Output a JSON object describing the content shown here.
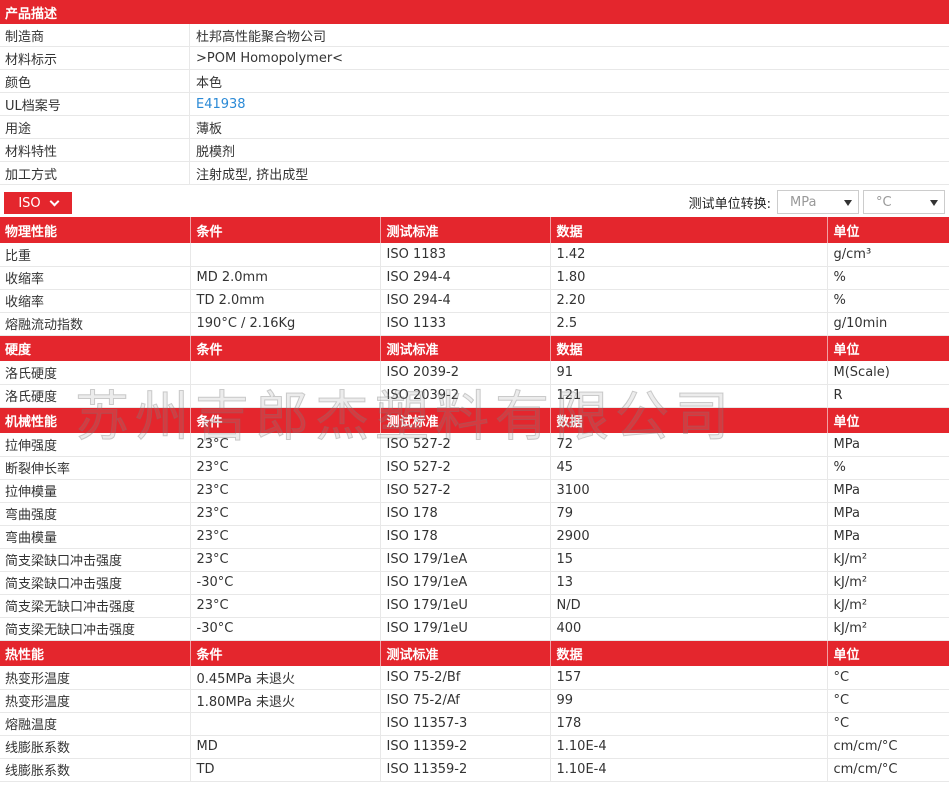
{
  "description": {
    "title": "产品描述",
    "rows": [
      {
        "key": "制造商",
        "value": "杜邦高性能聚合物公司"
      },
      {
        "key": "材料标示",
        "value": ">POM Homopolymer<"
      },
      {
        "key": "颜色",
        "value": "本色"
      },
      {
        "key": "UL档案号",
        "value": "E41938"
      },
      {
        "key": "用途",
        "value": "薄板"
      },
      {
        "key": "材料特性",
        "value": "脱模剂"
      },
      {
        "key": "加工方式",
        "value": "注射成型, 挤出成型"
      }
    ]
  },
  "toolbar": {
    "standard": "ISO",
    "unit_label": "测试单位转换:",
    "pressure_unit": "MPa",
    "temp_unit": "°C"
  },
  "columns": {
    "condition": "条件",
    "standard": "测试标准",
    "data": "数据",
    "unit": "单位"
  },
  "sections": [
    {
      "title": "物理性能",
      "rows": [
        [
          "比重",
          "",
          "ISO 1183",
          "1.42",
          "g/cm³"
        ],
        [
          "收缩率",
          "MD 2.0mm",
          "ISO 294-4",
          "1.80",
          "%"
        ],
        [
          "收缩率",
          "TD 2.0mm",
          "ISO 294-4",
          "2.20",
          "%"
        ],
        [
          "熔融流动指数",
          "190°C / 2.16Kg",
          "ISO 1133",
          "2.5",
          "g/10min"
        ]
      ]
    },
    {
      "title": "硬度",
      "rows": [
        [
          "洛氏硬度",
          "",
          "ISO 2039-2",
          "91",
          "M(Scale)"
        ],
        [
          "洛氏硬度",
          "",
          "ISO 2039-2",
          "121",
          "R"
        ]
      ]
    },
    {
      "title": "机械性能",
      "rows": [
        [
          "拉伸强度",
          "23°C",
          "ISO 527-2",
          "72",
          "MPa"
        ],
        [
          "断裂伸长率",
          "23°C",
          "ISO 527-2",
          "45",
          "%"
        ],
        [
          "拉伸模量",
          "23°C",
          "ISO 527-2",
          "3100",
          "MPa"
        ],
        [
          "弯曲强度",
          "23°C",
          "ISO 178",
          "79",
          "MPa"
        ],
        [
          "弯曲模量",
          "23°C",
          "ISO 178",
          "2900",
          "MPa"
        ],
        [
          "简支梁缺口冲击强度",
          "23°C",
          "ISO 179/1eA",
          "15",
          "kJ/m²"
        ],
        [
          "简支梁缺口冲击强度",
          "-30°C",
          "ISO 179/1eA",
          "13",
          "kJ/m²"
        ],
        [
          "简支梁无缺口冲击强度",
          "23°C",
          "ISO 179/1eU",
          "N/D",
          "kJ/m²"
        ],
        [
          "简支梁无缺口冲击强度",
          "-30°C",
          "ISO 179/1eU",
          "400",
          "kJ/m²"
        ]
      ]
    },
    {
      "title": "热性能",
      "rows": [
        [
          "热变形温度",
          "0.45MPa 未退火",
          "ISO 75-2/Bf",
          "157",
          "°C"
        ],
        [
          "热变形温度",
          "1.80MPa 未退火",
          "ISO 75-2/Af",
          "99",
          "°C"
        ],
        [
          "熔融温度",
          "",
          "ISO 11357-3",
          "178",
          "°C"
        ],
        [
          "线膨胀系数",
          "MD",
          "ISO 11359-2",
          "1.10E-4",
          "cm/cm/°C"
        ],
        [
          "线膨胀系数",
          "TD",
          "ISO 11359-2",
          "1.10E-4",
          "cm/cm/°C"
        ]
      ]
    }
  ],
  "watermark": "苏州吉郎杰塑料有限公司",
  "colors": {
    "accent": "#e4262d",
    "link": "#2b8ad6"
  }
}
